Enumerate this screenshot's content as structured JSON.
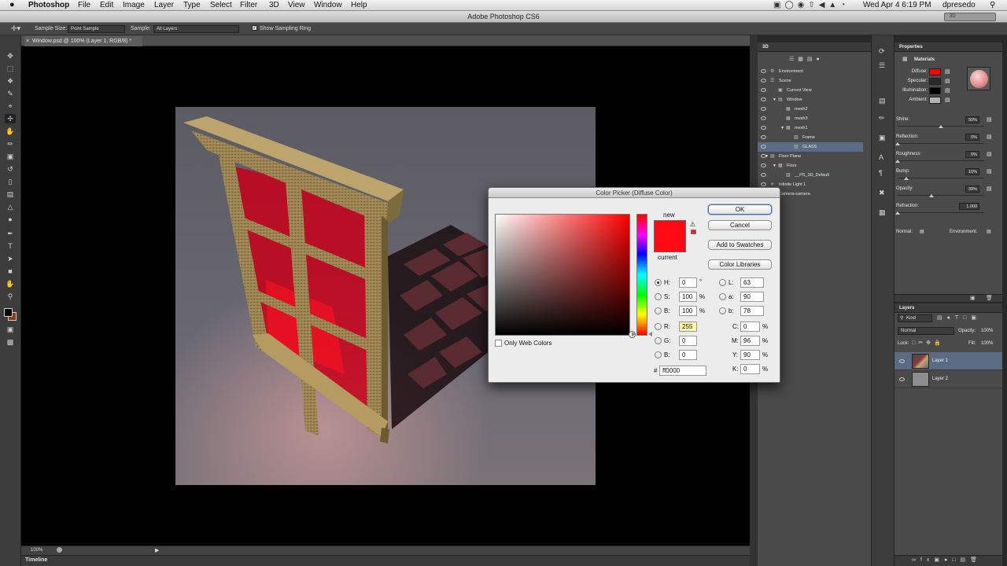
{
  "menubar": {
    "apple": "",
    "app": "Photoshop",
    "items": [
      "File",
      "Edit",
      "Image",
      "Layer",
      "Type",
      "Select",
      "Filter",
      "3D",
      "View",
      "Window",
      "Help"
    ],
    "clock": "Wed Apr 4  6:19 PM",
    "user": "dpresedo"
  },
  "window": {
    "title": "Adobe Photoshop CS6",
    "workspace": "3D"
  },
  "options_bar": {
    "sample_size_label": "Sample Size:",
    "sample_size_value": "Point Sample",
    "sample_label": "Sample:",
    "sample_value": "All Layers",
    "show_ring_label": "Show Sampling Ring",
    "show_ring_checked": true
  },
  "document": {
    "tab": "Window.psd @ 100% (Layer 1, RGB/8) *",
    "zoom": "100%",
    "timeline": "Timeline"
  },
  "panel_3d": {
    "title": "3D",
    "items": [
      {
        "label": "Environment",
        "indent": 0,
        "type": "env"
      },
      {
        "label": "Scene",
        "indent": 0,
        "type": "scene"
      },
      {
        "label": "Current View",
        "indent": 1,
        "type": "camera"
      },
      {
        "label": "Window",
        "indent": 1,
        "type": "folder",
        "expanded": true
      },
      {
        "label": "mesh2",
        "indent": 2,
        "type": "mesh"
      },
      {
        "label": "mesh3",
        "indent": 2,
        "type": "mesh"
      },
      {
        "label": "mesh1",
        "indent": 2,
        "type": "mesh",
        "expanded": true
      },
      {
        "label": "Frame",
        "indent": 3,
        "type": "material"
      },
      {
        "label": "GLASS",
        "indent": 3,
        "type": "material",
        "selected": true
      },
      {
        "label": "Floor Plane",
        "indent": 0,
        "type": "folder",
        "expanded": true
      },
      {
        "label": "Floor",
        "indent": 1,
        "type": "mesh",
        "expanded": true
      },
      {
        "label": "__PS_3D_Default",
        "indent": 2,
        "type": "material"
      },
      {
        "label": "Infinite Light 1",
        "indent": 0,
        "type": "light"
      },
      {
        "label": "Camera-camera",
        "indent": 0,
        "type": "camera"
      }
    ]
  },
  "properties": {
    "title": "Properties",
    "tab": "Materials",
    "swatches": [
      {
        "label": "Diffuse:",
        "color": "#ff0000"
      },
      {
        "label": "Specular:",
        "color": "#2a2a2a"
      },
      {
        "label": "Illumination:",
        "color": "#000000"
      },
      {
        "label": "Ambient:",
        "color": "#b4b4b4"
      }
    ],
    "sliders": [
      {
        "label": "Shine:",
        "value": "50%",
        "pos": 0.5
      },
      {
        "label": "Reflection:",
        "value": "0%",
        "pos": 0.0
      },
      {
        "label": "Roughness:",
        "value": "0%",
        "pos": 0.0
      },
      {
        "label": "Bump:",
        "value": "10%",
        "pos": 0.1
      },
      {
        "label": "Opacity:",
        "value": "39%",
        "pos": 0.39
      },
      {
        "label": "Refraction:",
        "value": "1.000",
        "pos": 0.0
      }
    ],
    "normal_label": "Normal:",
    "environment_label": "Environment:"
  },
  "layers": {
    "title": "Layers",
    "kind": "Kind",
    "blend_mode": "Normal",
    "opacity_label": "Opacity:",
    "opacity": "100%",
    "lock_label": "Lock:",
    "fill_label": "Fill:",
    "fill": "100%",
    "items": [
      {
        "name": "Layer 1",
        "selected": true
      },
      {
        "name": "Layer 2",
        "selected": false
      }
    ]
  },
  "color_picker": {
    "title": "Color Picker (Diffuse Color)",
    "buttons": {
      "ok": "OK",
      "cancel": "Cancel",
      "add": "Add to Swatches",
      "libraries": "Color Libraries"
    },
    "new_label": "new",
    "current_label": "current",
    "new_color": "#ff0a14",
    "current_color": "#ff0a14",
    "only_web": "Only Web Colors",
    "hsb": {
      "H": "0",
      "S": "100",
      "B": "100"
    },
    "rgb": {
      "R": "255",
      "G": "0",
      "B": "0"
    },
    "lab": {
      "L": "63",
      "a": "90",
      "b": "78"
    },
    "cmyk": {
      "C": "0",
      "M": "96",
      "Y": "90",
      "K": "0"
    },
    "hex": "ff0000",
    "labels": {
      "H": "H:",
      "S": "S:",
      "Bb": "B:",
      "R": "R:",
      "G": "G:",
      "B": "B:",
      "L": "L:",
      "a": "a:",
      "b": "b:",
      "C": "C:",
      "M": "M:",
      "Y": "Y:",
      "K": "K:",
      "hash": "#"
    },
    "units": {
      "deg": "°",
      "pct": "%"
    }
  }
}
